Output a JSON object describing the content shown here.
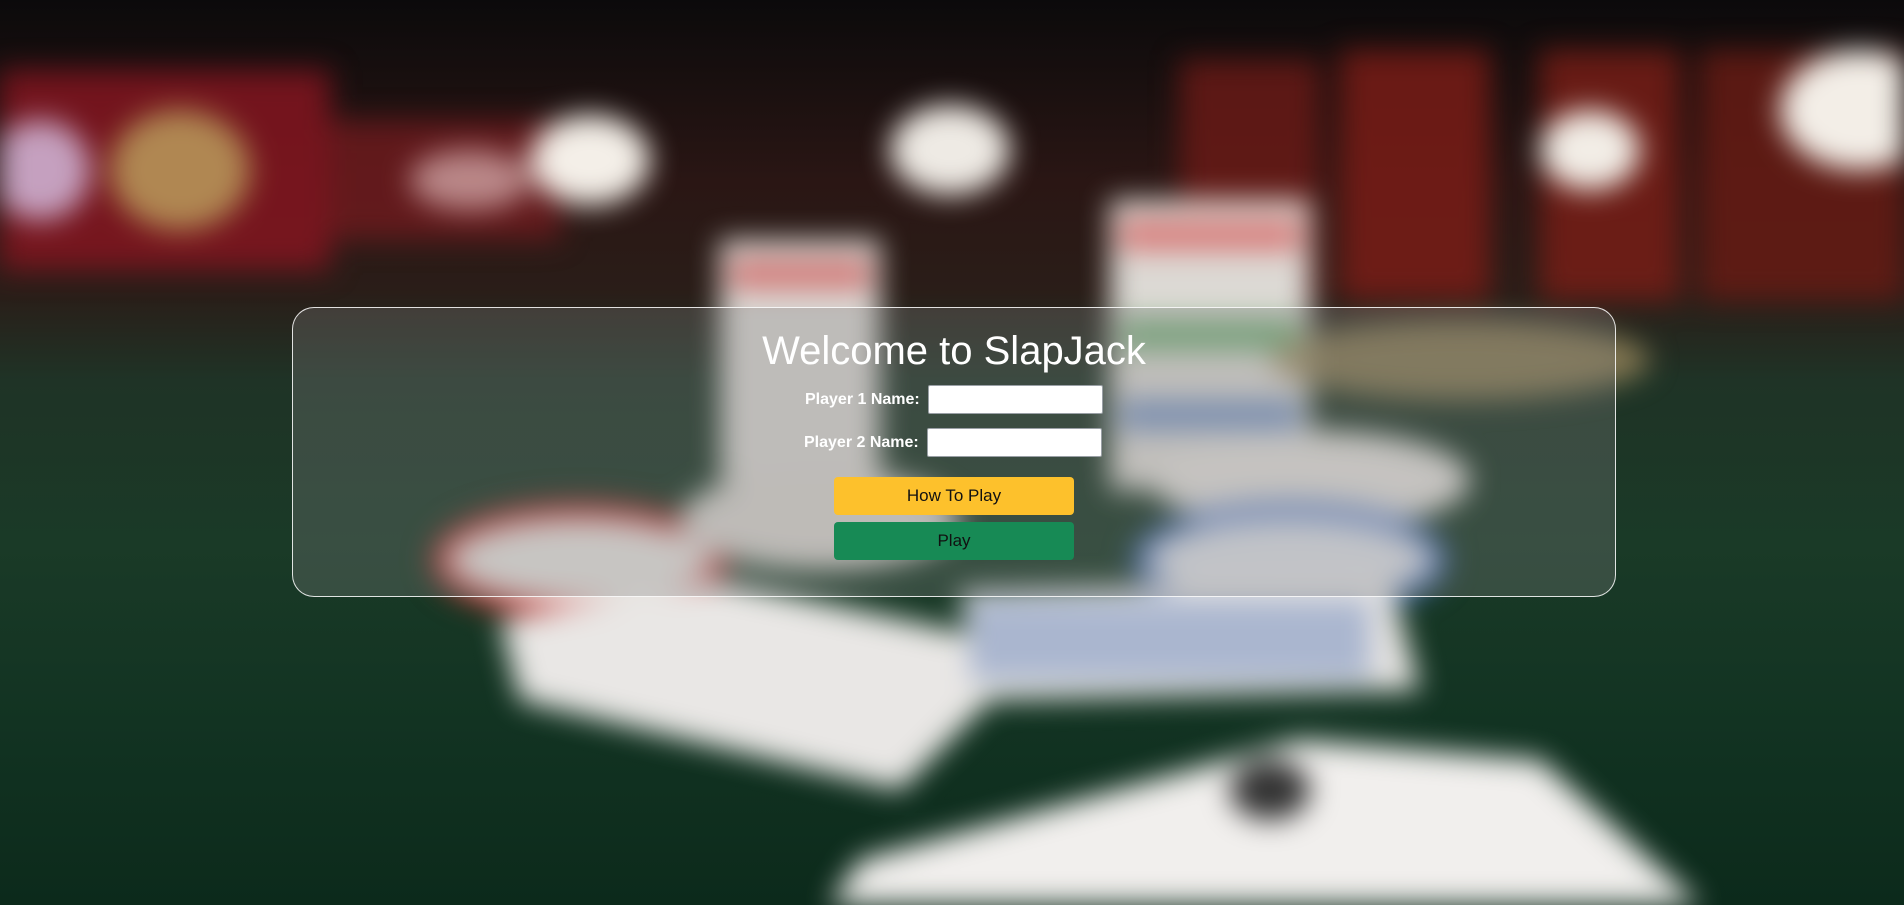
{
  "page": {
    "title": "Welcome to SlapJack"
  },
  "form": {
    "player1": {
      "label": "Player 1 Name:",
      "value": "",
      "placeholder": ""
    },
    "player2": {
      "label": "Player 2 Name:",
      "value": "",
      "placeholder": ""
    }
  },
  "buttons": {
    "how_to_play": {
      "label": "How To Play",
      "color": "#fdc12c"
    },
    "play": {
      "label": "Play",
      "color": "#178a55"
    }
  },
  "background": {
    "description_icon": "casino-table-background"
  }
}
